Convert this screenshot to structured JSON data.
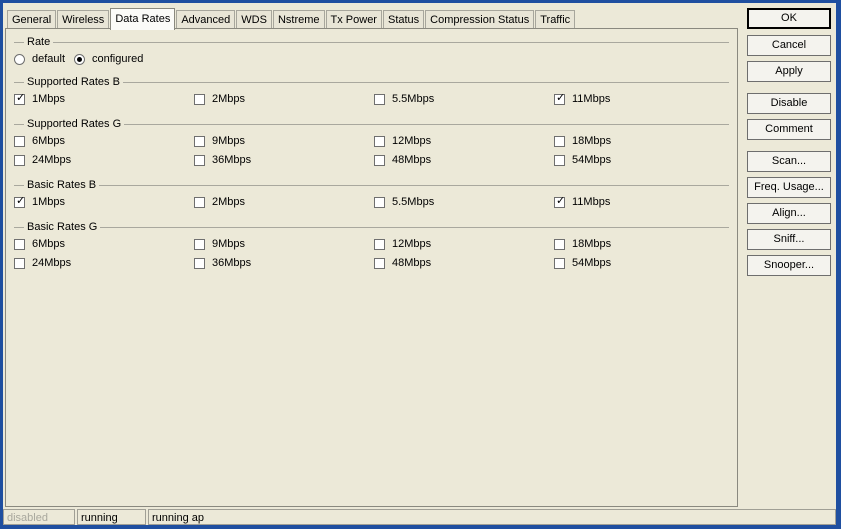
{
  "tabs": [
    "General",
    "Wireless",
    "Data Rates",
    "Advanced",
    "WDS",
    "Nstreme",
    "Tx Power",
    "Status",
    "Compression Status",
    "Traffic"
  ],
  "active_tab": "Data Rates",
  "rate": {
    "title": "Rate",
    "options": [
      {
        "label": "default",
        "selected": false
      },
      {
        "label": "configured",
        "selected": true
      }
    ]
  },
  "supported_b": {
    "title": "Supported Rates B",
    "items": [
      {
        "label": "1Mbps",
        "checked": true
      },
      {
        "label": "2Mbps",
        "checked": false
      },
      {
        "label": "5.5Mbps",
        "checked": false
      },
      {
        "label": "11Mbps",
        "checked": true
      }
    ]
  },
  "supported_g": {
    "title": "Supported Rates G",
    "items": [
      {
        "label": "6Mbps",
        "checked": false
      },
      {
        "label": "9Mbps",
        "checked": false
      },
      {
        "label": "12Mbps",
        "checked": false
      },
      {
        "label": "18Mbps",
        "checked": false
      },
      {
        "label": "24Mbps",
        "checked": false
      },
      {
        "label": "36Mbps",
        "checked": false
      },
      {
        "label": "48Mbps",
        "checked": false
      },
      {
        "label": "54Mbps",
        "checked": false
      }
    ]
  },
  "basic_b": {
    "title": "Basic Rates B",
    "items": [
      {
        "label": "1Mbps",
        "checked": true
      },
      {
        "label": "2Mbps",
        "checked": false
      },
      {
        "label": "5.5Mbps",
        "checked": false
      },
      {
        "label": "11Mbps",
        "checked": true
      }
    ]
  },
  "basic_g": {
    "title": "Basic Rates G",
    "items": [
      {
        "label": "6Mbps",
        "checked": false
      },
      {
        "label": "9Mbps",
        "checked": false
      },
      {
        "label": "12Mbps",
        "checked": false
      },
      {
        "label": "18Mbps",
        "checked": false
      },
      {
        "label": "24Mbps",
        "checked": false
      },
      {
        "label": "36Mbps",
        "checked": false
      },
      {
        "label": "48Mbps",
        "checked": false
      },
      {
        "label": "54Mbps",
        "checked": false
      }
    ]
  },
  "buttons": {
    "ok": "OK",
    "cancel": "Cancel",
    "apply": "Apply",
    "disable": "Disable",
    "comment": "Comment",
    "scan": "Scan...",
    "freq_usage": "Freq. Usage...",
    "align": "Align...",
    "sniff": "Sniff...",
    "snooper": "Snooper..."
  },
  "status_bar": {
    "state": "disabled",
    "running": "running",
    "mode": "running ap"
  }
}
